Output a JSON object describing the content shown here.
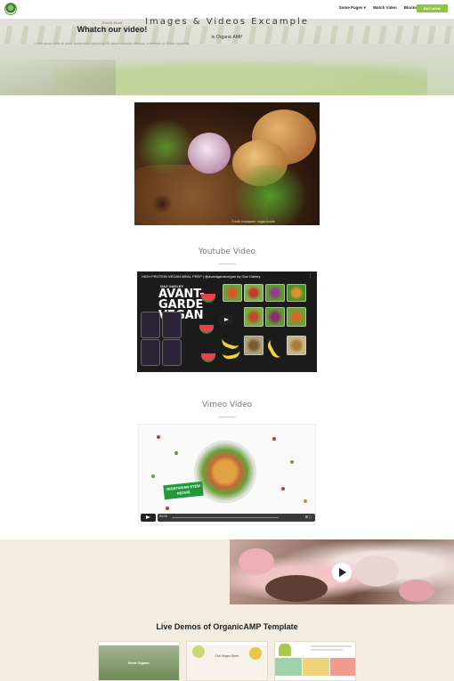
{
  "nav": {
    "items": [
      "Some Pages ▾",
      "Watch Video",
      "Blocks ▾"
    ],
    "buy_label": "BUY NOW"
  },
  "hero": {
    "title": "Images & Videos Excample",
    "subtitle": "in Organic AMP"
  },
  "feature_image": {
    "caption": "Credit: Instagram: vegan.foodie"
  },
  "youtube": {
    "heading": "Youtube Video",
    "video_title": "HIGH PROTEIN VEGAN MEAL PREP | @avantgardevegan by Gaz Oakley",
    "overlay_text": "AVANT-GARDE VEGAN",
    "overlay_sub": "GAZ OAKLEY"
  },
  "vimeo": {
    "heading": "Vimeo Video",
    "label": "VEGETARIAN STEW RECIPE",
    "time": "01:19"
  },
  "watch": {
    "kicker": "Fresh Food",
    "title": "Whatch our video!",
    "text": "Lorem ipsum dolor sit amet, consectetur adipiscing elit. Ipsum molestie interdum, a molestie et. Mauris imperdiet."
  },
  "demos": {
    "title": "Live Demos of OrganicAMP Template",
    "thumbs": [
      "Home Organic",
      "Our Vegan Store",
      ""
    ]
  },
  "colors": {
    "accent_green": "#8dc63f",
    "beige": "#f5ede1"
  }
}
